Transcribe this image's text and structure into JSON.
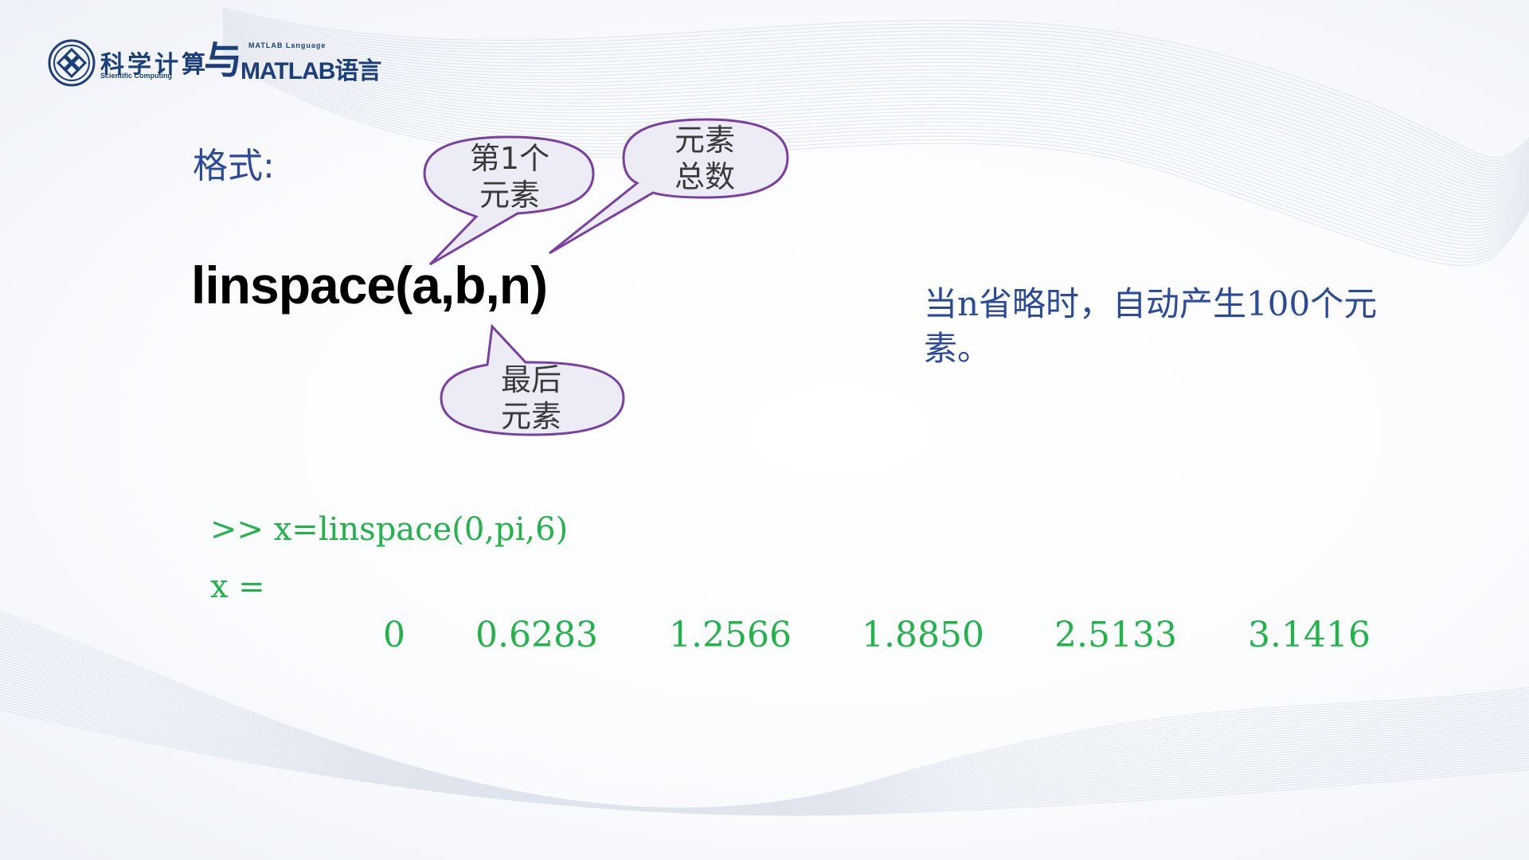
{
  "logo": {
    "title_cn": "科学计算",
    "subtitle_en": "Scientific Computing",
    "connector": "与",
    "matlab_small": "MATLAB Language",
    "matlab_main": "MATLAB语言"
  },
  "heading": "格式:",
  "formula": "linspace(a,b,n)",
  "callouts": {
    "first": [
      "第1个",
      "元素"
    ],
    "total": [
      "元素",
      "总数"
    ],
    "last": [
      "最后",
      "元素"
    ]
  },
  "note": "当n省略时，自动产生100个元素。",
  "console": {
    "command": ">> x=linspace(0,pi,6)",
    "var_line": "x =",
    "values": [
      "0",
      "0.6283",
      "1.2566",
      "1.8850",
      "2.5133",
      "3.1416"
    ]
  },
  "colors": {
    "heading": "#2c4a9a",
    "callout_border": "#7a3fa0",
    "console_text": "#22b34a",
    "logo": "#1b3f7a"
  }
}
